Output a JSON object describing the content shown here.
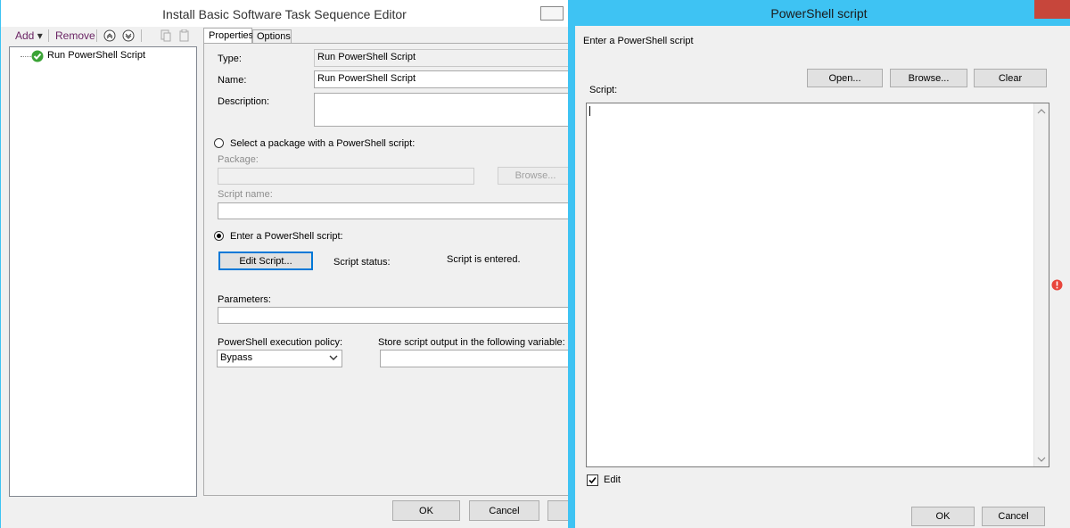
{
  "editor": {
    "title": "Install Basic Software Task Sequence Editor",
    "toolbar": {
      "add": "Add",
      "add_arrow": "▾",
      "remove": "Remove"
    },
    "tree": {
      "item": "Run PowerShell Script"
    },
    "tabs": [
      "Properties",
      "Options"
    ],
    "props": {
      "type_label": "Type:",
      "type_value": "Run PowerShell Script",
      "name_label": "Name:",
      "name_value": "Run PowerShell Script",
      "description_label": "Description:",
      "description_value": "",
      "radio_package": "Select a package with a PowerShell script:",
      "package_label": "Package:",
      "package_value": "",
      "browse_button": "Browse...",
      "script_name_label": "Script name:",
      "script_name_value": "",
      "radio_enter": "Enter a PowerShell script:",
      "edit_script_button": "Edit Script...",
      "script_status_label": "Script status:",
      "script_status_value": "Script is entered.",
      "parameters_label": "Parameters:",
      "parameters_value": "",
      "policy_label": "PowerShell execution policy:",
      "policy_value": "Bypass",
      "output_var_label": "Store script output in the following variable:",
      "output_var_value": ""
    },
    "footer": {
      "ok": "OK",
      "cancel": "Cancel"
    }
  },
  "dialog": {
    "title": "PowerShell script",
    "prompt": "Enter a PowerShell script",
    "open_button": "Open...",
    "browse_button": "Browse...",
    "clear_button": "Clear",
    "script_label": "Script:",
    "script_value": "",
    "edit_checkbox": "Edit",
    "edit_checked": true,
    "ok": "OK",
    "cancel": "Cancel"
  },
  "colors": {
    "accent": "#3ec3f3",
    "focus": "#0078d7",
    "error": "#e8453c",
    "check": "#3aa335"
  }
}
